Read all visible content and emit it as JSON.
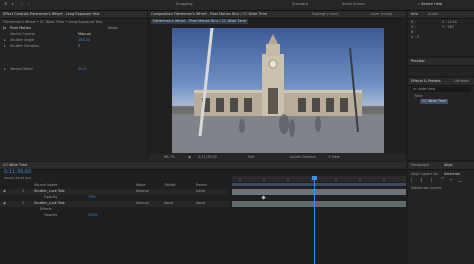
{
  "topbar": {
    "left_items": [
      "☰",
      "▸",
      "⬚",
      "⌕"
    ],
    "workspace": "Snapping",
    "tabs": [
      "Standard",
      "Small Screen"
    ],
    "search": "⌕ Search Help"
  },
  "effect_controls": {
    "tab": "Effect Controls Fisherman's Wharf - Long Exposure Test",
    "breadcrumb": "Fisherman's Wharf • CC Wide Time • Long Exposure Test",
    "effect_name": "Pixel Motion",
    "effect_right": "Reset",
    "rows": [
      {
        "label": "Vector Control",
        "value": "Manual"
      },
      {
        "label": "Shutter Angle",
        "value": "180.00"
      },
      {
        "label": "Shutter Samples",
        "value": "8"
      },
      {
        "label": "Vector Detail",
        "value": "20.0"
      }
    ]
  },
  "composition": {
    "tab": "Composition Fisherman's Wharf - Pixel Motion Blur / CC Wide Time",
    "other_tabs": [
      "Footage (none)",
      "Layer (none)"
    ],
    "breadcrumb": "Fisherman's Wharf - Pixel Motion Blur / CC Wide Time",
    "zoom": "66.7%",
    "timecode": "0;11;30;02",
    "resolution": "Full",
    "camera": "Active Camera",
    "views": "1 View"
  },
  "info_panel": {
    "tab": "Info",
    "audio_tab": "Audio",
    "lines": [
      "R :",
      "G :",
      "B :",
      "A : 0"
    ],
    "coords": [
      "X : 1216",
      "Y : 587"
    ]
  },
  "preview_panel": {
    "tab": "Preview"
  },
  "effects_presets": {
    "tab": "Effects & Presets",
    "libraries_tab": "Libraries",
    "search": "cc wide time",
    "category": "Time",
    "item": "CC Wide Time"
  },
  "align_panel": {
    "tabs": [
      "Paragraph",
      "Align"
    ],
    "align_label": "Align Layers to:",
    "align_target": "Selection",
    "distribute_label": "Distribute Layers:"
  },
  "timeline": {
    "tab": "CC Wide Time",
    "timecode": "0;11;30;02",
    "fps": "00342 (29.97 fps)",
    "columns": {
      "source": "Source Name",
      "mode": "Mode",
      "trkmat": "TrkMat",
      "parent": "Parent"
    },
    "layers": [
      {
        "num": "1",
        "name": "Shutter_Luck Test",
        "mode": "Normal",
        "parent": "None"
      },
      {
        "num": "2",
        "name": "Shutter_Luck Test",
        "mode": "Normal",
        "trkmat": "None",
        "parent": "None"
      }
    ],
    "sub_rows": [
      "Opacity",
      "Effects",
      "Opacity"
    ],
    "sub_values": [
      "75%",
      "",
      "100%"
    ]
  }
}
